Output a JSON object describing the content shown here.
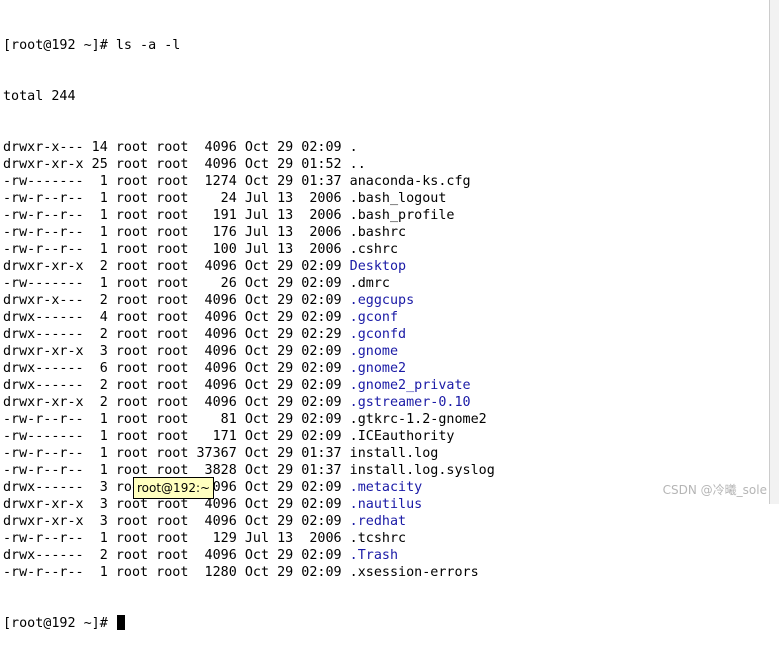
{
  "terminal": {
    "prompt_command": "[root@192 ~]# ls -a -l",
    "total": "total 244",
    "entries": [
      {
        "meta": "drwxr-x--- 14 root root  4096 Oct 29 02:09 ",
        "name": ".",
        "is_dir": false
      },
      {
        "meta": "drwxr-xr-x 25 root root  4096 Oct 29 01:52 ",
        "name": "..",
        "is_dir": false
      },
      {
        "meta": "-rw-------  1 root root  1274 Oct 29 01:37 ",
        "name": "anaconda-ks.cfg",
        "is_dir": false
      },
      {
        "meta": "-rw-r--r--  1 root root    24 Jul 13  2006 ",
        "name": ".bash_logout",
        "is_dir": false
      },
      {
        "meta": "-rw-r--r--  1 root root   191 Jul 13  2006 ",
        "name": ".bash_profile",
        "is_dir": false
      },
      {
        "meta": "-rw-r--r--  1 root root   176 Jul 13  2006 ",
        "name": ".bashrc",
        "is_dir": false
      },
      {
        "meta": "-rw-r--r--  1 root root   100 Jul 13  2006 ",
        "name": ".cshrc",
        "is_dir": false
      },
      {
        "meta": "drwxr-xr-x  2 root root  4096 Oct 29 02:09 ",
        "name": "Desktop",
        "is_dir": true
      },
      {
        "meta": "-rw-------  1 root root    26 Oct 29 02:09 ",
        "name": ".dmrc",
        "is_dir": false
      },
      {
        "meta": "drwxr-x---  2 root root  4096 Oct 29 02:09 ",
        "name": ".eggcups",
        "is_dir": true
      },
      {
        "meta": "drwx------  4 root root  4096 Oct 29 02:09 ",
        "name": ".gconf",
        "is_dir": true
      },
      {
        "meta": "drwx------  2 root root  4096 Oct 29 02:29 ",
        "name": ".gconfd",
        "is_dir": true
      },
      {
        "meta": "drwxr-xr-x  3 root root  4096 Oct 29 02:09 ",
        "name": ".gnome",
        "is_dir": true
      },
      {
        "meta": "drwx------  6 root root  4096 Oct 29 02:09 ",
        "name": ".gnome2",
        "is_dir": true
      },
      {
        "meta": "drwx------  2 root root  4096 Oct 29 02:09 ",
        "name": ".gnome2_private",
        "is_dir": true
      },
      {
        "meta": "drwxr-xr-x  2 root root  4096 Oct 29 02:09 ",
        "name": ".gstreamer-0.10",
        "is_dir": true
      },
      {
        "meta": "-rw-r--r--  1 root root    81 Oct 29 02:09 ",
        "name": ".gtkrc-1.2-gnome2",
        "is_dir": false
      },
      {
        "meta": "-rw-------  1 root root   171 Oct 29 02:09 ",
        "name": ".ICEauthority",
        "is_dir": false
      },
      {
        "meta": "-rw-r--r--  1 root root 37367 Oct 29 01:37 ",
        "name": "install.log",
        "is_dir": false
      },
      {
        "meta": "-rw-r--r--  1 root root  3828 Oct 29 01:37 ",
        "name": "install.log.syslog",
        "is_dir": false
      },
      {
        "meta": "drwx------  3 root root  4096 Oct 29 02:09 ",
        "name": ".metacity",
        "is_dir": true
      },
      {
        "meta": "drwxr-xr-x  3 root root  4096 Oct 29 02:09 ",
        "name": ".nautilus",
        "is_dir": true
      },
      {
        "meta": "drwxr-xr-x  3 root root  4096 Oct 29 02:09 ",
        "name": ".redhat",
        "is_dir": true
      },
      {
        "meta": "-rw-r--r--  1 root root   129 Jul 13  2006 ",
        "name": ".tcshrc",
        "is_dir": false
      },
      {
        "meta": "drwx------  2 root root  4096 Oct 29 02:09 ",
        "name": ".Trash",
        "is_dir": true
      },
      {
        "meta": "-rw-r--r--  1 root root  1280 Oct 29 02:09 ",
        "name": ".xsession-errors",
        "is_dir": false
      }
    ],
    "final_prompt": "[root@192 ~]# ",
    "tooltip": "root@192:~",
    "dir_color": "#1a1aa6"
  },
  "watermark": "CSDN @冷曦_sole"
}
